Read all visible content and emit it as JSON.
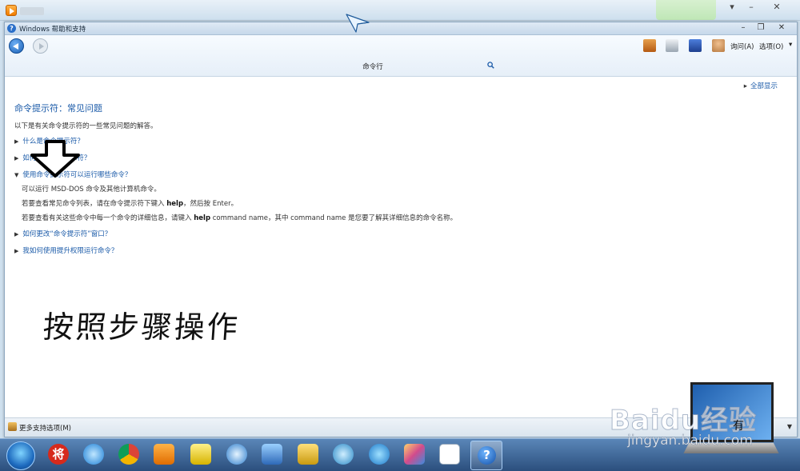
{
  "window": {
    "title": "Windows 帮助和支持"
  },
  "toolbar": {
    "ask_label": "询问(A)",
    "options_label": "选项(O)"
  },
  "search": {
    "value": "命令行"
  },
  "content": {
    "show_all": "全部显示",
    "heading": "命令提示符：常见问题",
    "intro": "以下是有关命令提示符的一些常见问题的解答。",
    "faq": [
      {
        "q": "什么是命令提示符？"
      },
      {
        "q": "如何打开命令提示符？"
      },
      {
        "q": "使用命令提示符可以运行哪些命令？"
      },
      {
        "q": "如何更改“命令提示符”窗口？"
      },
      {
        "q": "我如何使用提升权限运行命令？"
      }
    ],
    "answer": {
      "line1": "可以运行 MSD-DOS 命令及其他计算机命令。",
      "line2_pre": "若要查看常见命令列表，请在命令提示符下键入 ",
      "line2_bold": "help",
      "line2_post": "，然后按 Enter。",
      "line3_pre": "若要查看有关这些命令中每一个命令的详细信息，请键入 ",
      "line3_bold": "help",
      "line3_post": " command name，其中 command name 是您要了解其详细信息的命令名称。"
    },
    "handwritten": "按照步骤操作"
  },
  "status": {
    "more_support": "更多支持选项(M)"
  },
  "taskbar": {
    "items": [
      "start-orb",
      "jiang-app-icon",
      "ie-icon",
      "chrome-icon",
      "media-player-icon",
      "folder-notes-icon",
      "globe-browser-icon",
      "screenshot-tool-icon",
      "file-manager-icon",
      "network-tool-icon",
      "media-center-icon",
      "paint-icon",
      "baidu-cloud-icon",
      "help-icon"
    ],
    "jiang_label": "将",
    "help_glyph": "?"
  },
  "watermark": {
    "baidu": "Baidu经验",
    "url": "jingyan.baidu.com",
    "tail": "有"
  },
  "colors": {
    "link": "#1a5aa8",
    "taskbar": "#2b4f7d"
  }
}
